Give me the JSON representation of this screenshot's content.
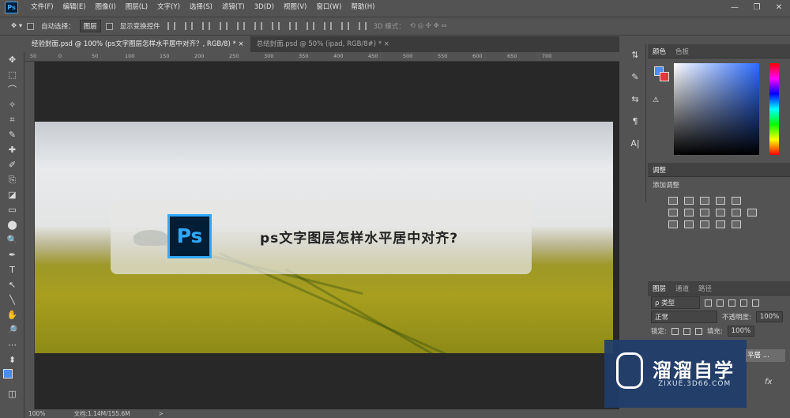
{
  "app": {
    "logo": "Ps",
    "window_controls": [
      "—",
      "❐",
      "✕"
    ]
  },
  "menubar": {
    "items": [
      "文件(F)",
      "编辑(E)",
      "图像(I)",
      "图层(L)",
      "文字(Y)",
      "选择(S)",
      "滤镜(T)",
      "3D(D)",
      "视图(V)",
      "窗口(W)",
      "帮助(H)"
    ]
  },
  "options": {
    "auto_select_label": "自动选择：",
    "auto_select_value": "图层",
    "show_transform_label": "显示变换控件",
    "mode_3d_label": "3D 模式："
  },
  "tabs": [
    {
      "label": "经验封面.psd @ 100% (ps文字图层怎样水平居中对齐？, RGB/8) *",
      "close": "×"
    },
    {
      "label": "总结封面.psd @ 50% (ipad, RGB/8#) *",
      "close": "×"
    }
  ],
  "ruler": {
    "ticks": [
      "50",
      "0",
      "50",
      "100",
      "150",
      "200",
      "250",
      "300",
      "350",
      "400",
      "450",
      "500",
      "550",
      "600",
      "650",
      "700"
    ]
  },
  "tools": [
    "✥",
    "⬚",
    "⌒",
    "✧",
    "⌗",
    "✎",
    "✚",
    "✐",
    "⎘",
    "◪",
    "▭",
    "⬤",
    "🔍",
    "✒",
    "T",
    "↖",
    "╲",
    "✋",
    "🔎",
    "⋯",
    "⬍",
    "◫"
  ],
  "canvas": {
    "banner_icon_text": "Ps",
    "banner_text": "ps文字图层怎样水平居中对齐?"
  },
  "status": {
    "zoom": "100%",
    "doc": "文档:1.14M/155.6M",
    "arrow": ">"
  },
  "strip_icons": [
    "⇅",
    "✎",
    "⇆",
    "¶",
    "A|"
  ],
  "panels": {
    "color": {
      "tabs": [
        "颜色",
        "色板"
      ]
    },
    "adjustments": {
      "tab": "调整",
      "title": "添加调整"
    },
    "layers": {
      "tabs": [
        "图层",
        "通道",
        "路径"
      ],
      "filter_label": "ρ 类型",
      "blend": "正常",
      "opacity_label": "不透明度:",
      "opacity": "100%",
      "lock_label": "锁定:",
      "fill_label": "填充:",
      "fill": "100%",
      "layer_name": "平居 ...",
      "fx": "fx"
    }
  },
  "watermark": {
    "title": "溜溜自学",
    "url": "ZIXUE.3D66.COM"
  },
  "colors": {
    "accent": "#31a8ff",
    "foreground": "#4a8cf0",
    "background": "#e03a3a"
  }
}
